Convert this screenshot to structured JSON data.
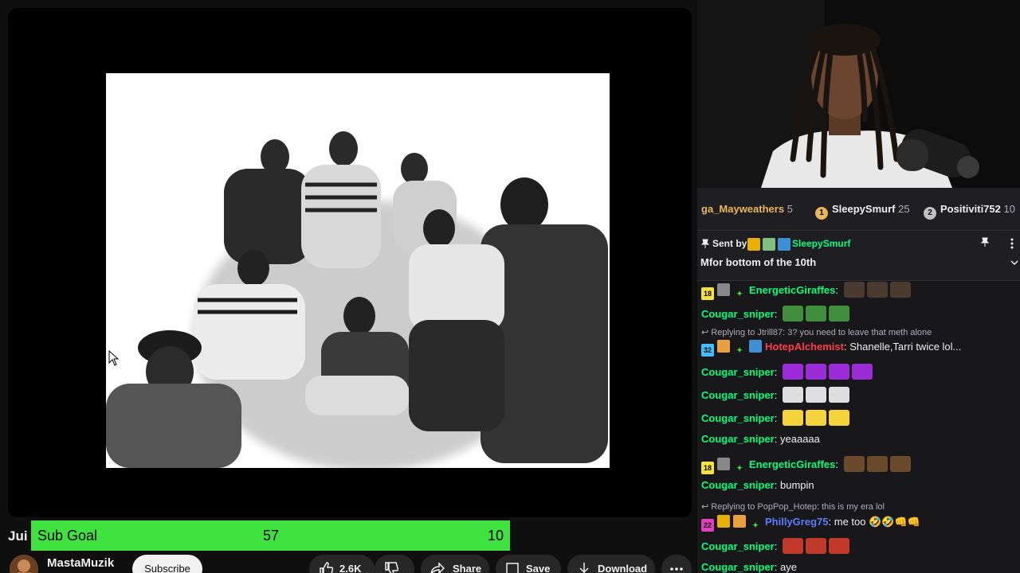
{
  "video": {
    "title_fragment": "Jui",
    "sub_goal": {
      "label": "Sub Goal",
      "current": "57",
      "goal": "10",
      "fill_fraction": 1.0,
      "color": "#3fe23f"
    },
    "channel": {
      "name": "MastaMuzik",
      "subscribe_label": "Subscribe"
    },
    "actions": {
      "like_count": "2.6K",
      "share_label": "Share",
      "save_label": "Save",
      "download_label": "Download"
    }
  },
  "chat": {
    "leaderboard": [
      {
        "name": "ga_Mayweathers",
        "count": "5",
        "rank_color": ""
      },
      {
        "name": "SleepySmurf",
        "count": "25",
        "rank": "1",
        "rank_color": "#eab65a"
      },
      {
        "name": "Positiviti752",
        "count": "10",
        "rank": "2",
        "rank_color": "#c0c0c0"
      }
    ],
    "pinned": {
      "sent_by_label": "Sent by",
      "sender": "SleepySmurf",
      "message": "Mfor bottom of the 10th"
    },
    "messages": [
      {
        "badge_num": "18",
        "user": "EnergeticGiraffes",
        "user_color": "#00ff7f",
        "text": "",
        "emotes": 3
      },
      {
        "user": "Cougar_sniper",
        "user_color": "#00ff7f",
        "text": "",
        "emotes": 3
      },
      {
        "reply": "Replying to Jtrill87: 3? you need to leave that meth alone"
      },
      {
        "badge_num": "32",
        "user": "HotepAlchemist",
        "user_color": "#ff3c4c",
        "text": "Shanelle,Tarri twice lol..."
      },
      {
        "user": "Cougar_sniper",
        "user_color": "#00ff7f",
        "text": "",
        "emotes": 4
      },
      {
        "user": "Cougar_sniper",
        "user_color": "#00ff7f",
        "text": "",
        "emotes": 3
      },
      {
        "user": "Cougar_sniper",
        "user_color": "#00ff7f",
        "text": "",
        "emotes": 3
      },
      {
        "user": "Cougar_sniper",
        "user_color": "#00ff7f",
        "text": "yeaaaaa"
      },
      {
        "badge_num": "18",
        "user": "EnergeticGiraffes",
        "user_color": "#00ff7f",
        "text": "",
        "emotes": 3
      },
      {
        "user": "Cougar_sniper",
        "user_color": "#00ff7f",
        "text": "bumpin"
      },
      {
        "reply": "Replying to PopPop_Hotep: this is my era lol"
      },
      {
        "badge_num": "22",
        "user": "PhillyGreg75",
        "user_color": "#5b7cff",
        "text": "me too 🤣🤣👊👊"
      },
      {
        "user": "Cougar_sniper",
        "user_color": "#00ff7f",
        "text": "",
        "emotes": 3
      },
      {
        "user": "Cougar_sniper",
        "user_color": "#00ff7f",
        "text": "aye"
      }
    ]
  },
  "colors": {
    "chat_bg": "#18181b",
    "player_bg": "#0f0f0f",
    "accent_green": "#00ff7f"
  }
}
